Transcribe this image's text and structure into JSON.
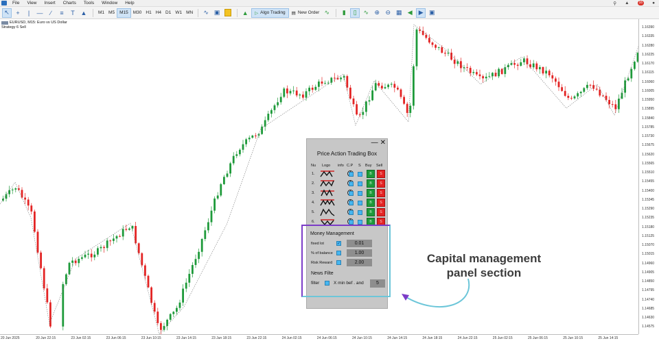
{
  "menu": [
    "File",
    "View",
    "Insert",
    "Charts",
    "Tools",
    "Window",
    "Help"
  ],
  "menu_right": {
    "badge": "16"
  },
  "toolbar": {
    "timeframes": [
      "M1",
      "M5",
      "M15",
      "M30",
      "H1",
      "H4",
      "D1",
      "W1",
      "MN"
    ],
    "active_timeframe": "M15",
    "algo_trading": "Algo Trading",
    "new_order": "New Order"
  },
  "chart_info": {
    "symbol_line": "EURUSD, M15:  Euro vs US Dollar",
    "strategy": "Strategy 6 Sell"
  },
  "price_axis": [
    "1.16390",
    "1.16335",
    "1.16280",
    "1.16225",
    "1.16170",
    "1.16115",
    "1.16060",
    "1.16005",
    "1.15950",
    "1.15895",
    "1.15840",
    "1.15785",
    "1.15730",
    "1.15675",
    "1.15620",
    "1.15565",
    "1.15510",
    "1.15455",
    "1.15400",
    "1.15345",
    "1.15290",
    "1.15235",
    "1.15180",
    "1.15125",
    "1.15070",
    "1.15015",
    "1.14960",
    "1.14905",
    "1.14850",
    "1.14795",
    "1.14740",
    "1.14685",
    "1.14630",
    "1.14575"
  ],
  "time_axis": [
    "20 Jun 2025",
    "20 Jun 22:15",
    "23 Jun 02:15",
    "23 Jun 06:15",
    "23 Jun 10:15",
    "23 Jun 14:15",
    "23 Jun 18:15",
    "23 Jun 22:15",
    "24 Jun 02:15",
    "24 Jun 06:15",
    "24 Jun 10:15",
    "24 Jun 14:15",
    "24 Jun 18:15",
    "24 Jun 22:15",
    "25 Jun 02:15",
    "25 Jun 06:15",
    "25 Jun 10:15",
    "25 Jun 14:15"
  ],
  "panel": {
    "title": "Price Action Trading Box",
    "headers": {
      "nu": "Nu",
      "logo": "Logo",
      "info": "info",
      "cp": "C.P",
      "s": "S",
      "buy": "Buy",
      "sell": "Sell"
    },
    "rows": [
      {
        "num": "1.",
        "info": "i",
        "buy": "B",
        "sell": "S"
      },
      {
        "num": "2.",
        "info": "i",
        "buy": "B",
        "sell": "S"
      },
      {
        "num": "3.",
        "info": "i",
        "buy": "B",
        "sell": "S"
      },
      {
        "num": "4.",
        "info": "i",
        "buy": "B",
        "sell": "S"
      },
      {
        "num": "5.",
        "info": "i",
        "buy": "B",
        "sell": "S"
      },
      {
        "num": "6.",
        "info": "i",
        "buy": "B",
        "sell": "S"
      }
    ],
    "money_management": {
      "title": "Money Management",
      "fixed_lot_label": "fixed lot",
      "fixed_lot_value": "0.01",
      "balance_label": "% of balance",
      "balance_value": "1.00",
      "risk_label": "Risk Reward",
      "risk_value": "2.00"
    },
    "news": {
      "title": "News Filte",
      "filter_label": "filter",
      "min_label": "X min bef . and",
      "min_value": "5"
    }
  },
  "callout": {
    "line1": "Capital management",
    "line2": "panel section"
  },
  "colors": {
    "bull": "#1e9a3a",
    "bear": "#e32424",
    "accent": "#7b3cc7",
    "arrow": "#6cc6d9"
  }
}
